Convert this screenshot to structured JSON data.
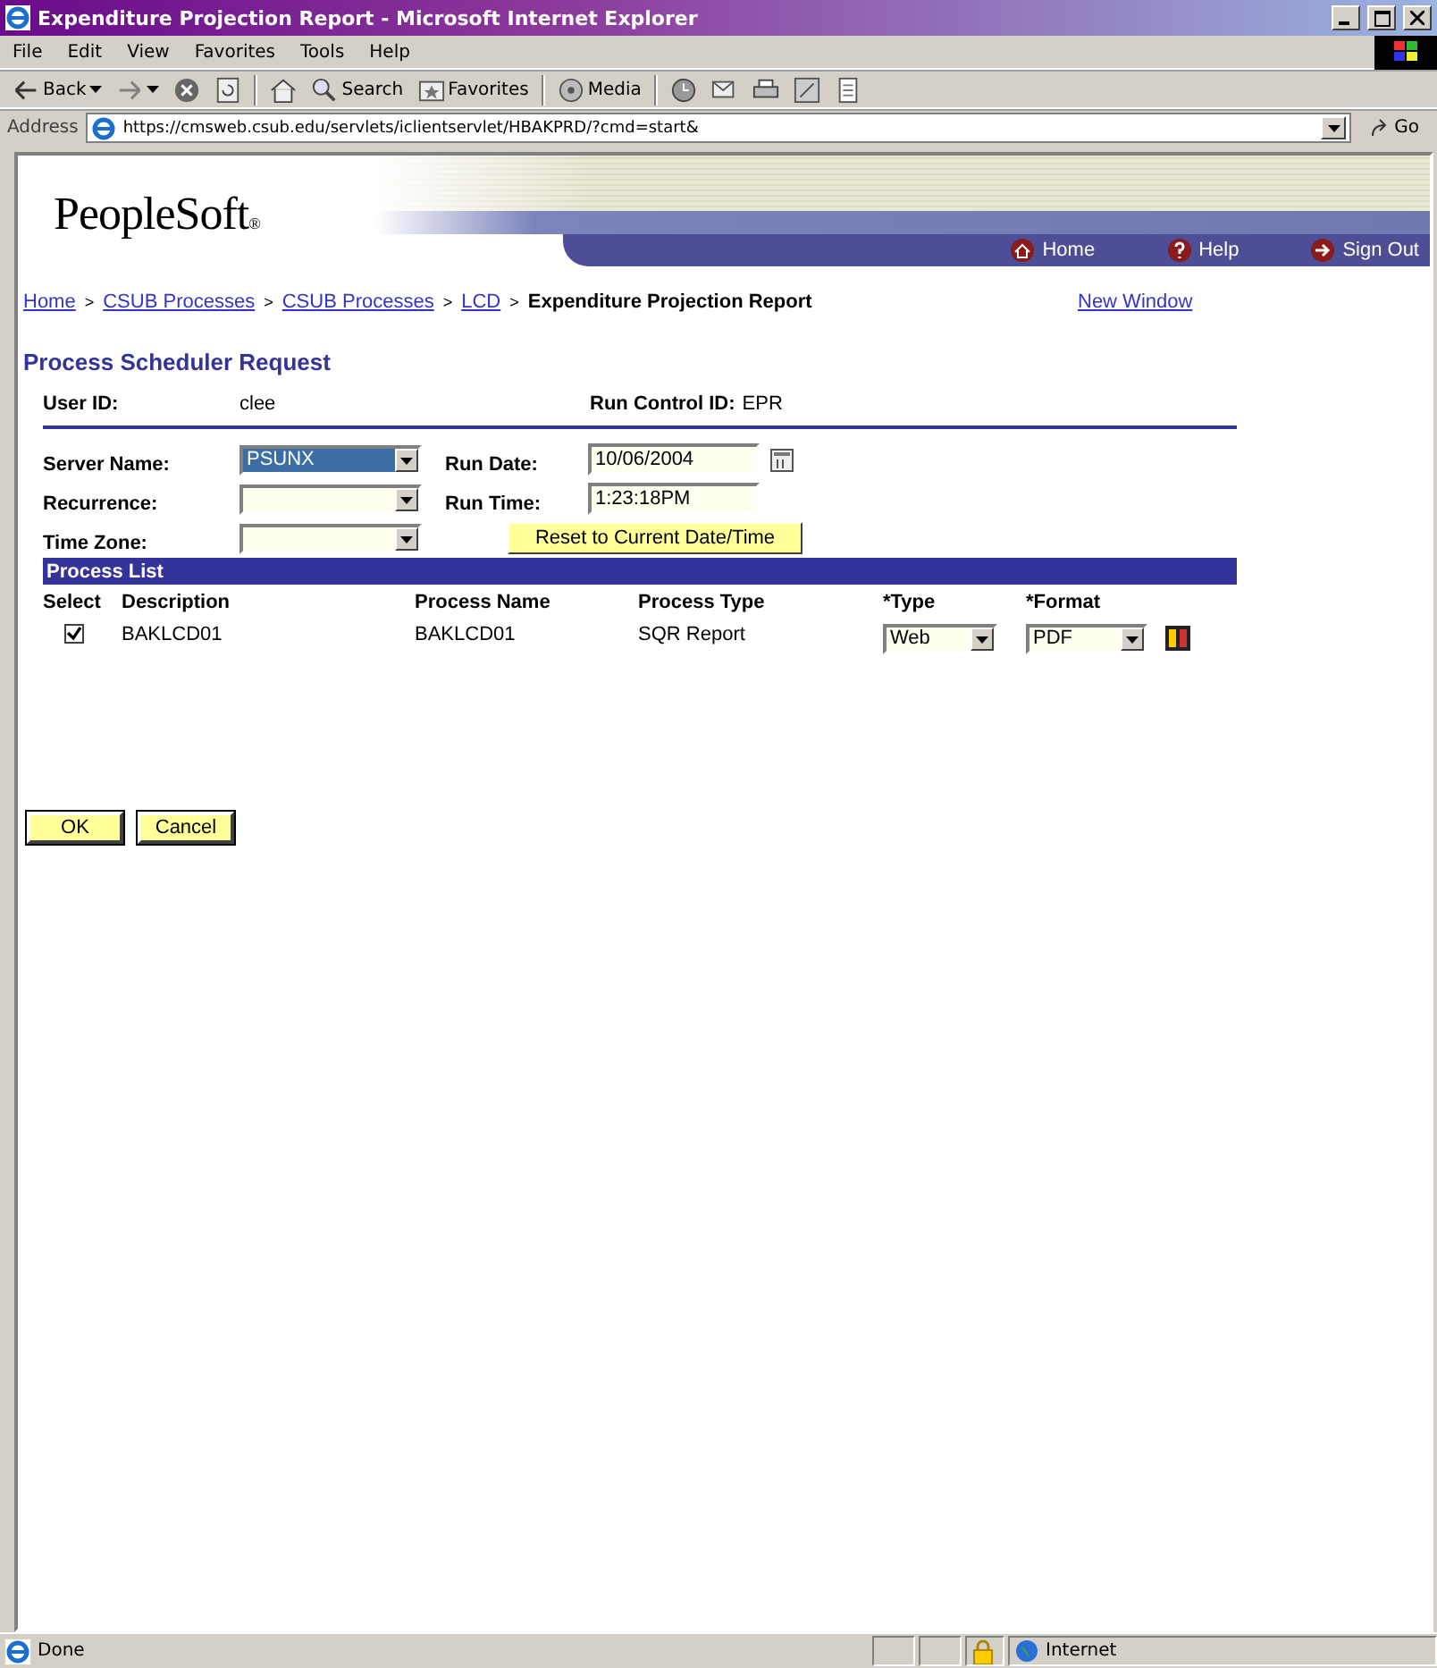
{
  "window": {
    "title": "Expenditure Projection Report - Microsoft Internet Explorer"
  },
  "menu": [
    "File",
    "Edit",
    "View",
    "Favorites",
    "Tools",
    "Help"
  ],
  "toolbar": [
    {
      "kind": "back",
      "label": "Back"
    },
    {
      "kind": "forward"
    },
    {
      "kind": "stop"
    },
    {
      "kind": "refresh"
    },
    {
      "kind": "home"
    },
    {
      "kind": "search",
      "label": "Search"
    },
    {
      "kind": "favorites",
      "label": "Favorites"
    },
    {
      "kind": "media",
      "label": "Media"
    },
    {
      "kind": "history"
    },
    {
      "kind": "mail"
    },
    {
      "kind": "print"
    },
    {
      "kind": "edit"
    },
    {
      "kind": "discuss"
    }
  ],
  "address": {
    "label": "Address",
    "url": "https://cmsweb.csub.edu/servlets/iclientservlet/HBAKPRD/?cmd=start&",
    "go": "Go"
  },
  "header": {
    "logo": "PeopleSoft",
    "logo_mark": "®",
    "nav": [
      {
        "kind": "home",
        "label": "Home"
      },
      {
        "kind": "help",
        "label": "Help"
      },
      {
        "kind": "signout",
        "label": "Sign Out"
      }
    ]
  },
  "breadcrumb": [
    {
      "kind": "link",
      "text": "Home"
    },
    {
      "kind": "separator",
      "text": ">"
    },
    {
      "kind": "link",
      "text": "CSUB Processes"
    },
    {
      "kind": "separator",
      "text": ">"
    },
    {
      "kind": "link",
      "text": "CSUB Processes"
    },
    {
      "kind": "separator",
      "text": ">"
    },
    {
      "kind": "link",
      "text": "LCD"
    },
    {
      "kind": "separator",
      "text": ">"
    },
    {
      "kind": "current",
      "text": "Expenditure Projection Report"
    }
  ],
  "new_window": "New Window",
  "page_title": "Process Scheduler Request",
  "user_id": {
    "label": "User ID:",
    "value": "clee"
  },
  "run_control_id": {
    "label": "Run Control ID:",
    "value": "EPR"
  },
  "server_name": {
    "label": "Server Name:",
    "value": "PSUNX",
    "selected": true
  },
  "recurrence": {
    "label": "Recurrence:",
    "selected": false
  },
  "time_zone": {
    "label": "Time Zone:",
    "selected": false
  },
  "run_date": {
    "label": "Run Date:",
    "value": "10/06/2004"
  },
  "run_time": {
    "label": "Run Time:",
    "value": "1:23:18PM"
  },
  "reset_button": "Reset to Current Date/Time",
  "process_list": {
    "title": "Process List",
    "columns": [
      "Select",
      "Description",
      "Process Name",
      "Process Type",
      "*Type",
      "*Format"
    ],
    "rows": [
      {
        "checked": true,
        "description": "BAKLCD01",
        "process_name": "BAKLCD01",
        "process_type": "SQR Report",
        "type": "Web",
        "format": "PDF"
      }
    ]
  },
  "buttons": [
    "OK",
    "Cancel"
  ],
  "status_bar": {
    "text": "Done",
    "zone": "Internet"
  }
}
